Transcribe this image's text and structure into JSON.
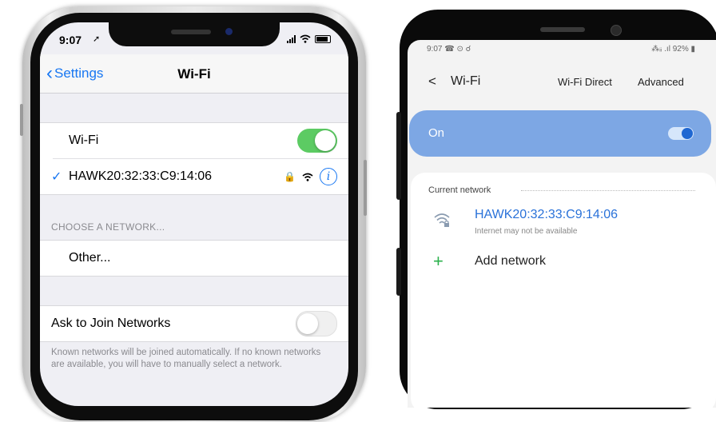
{
  "ios": {
    "status": {
      "time": "9:07"
    },
    "nav": {
      "back_label": "Settings",
      "title": "Wi-Fi"
    },
    "wifi_row": {
      "label": "Wi-Fi",
      "toggle_state": "on"
    },
    "connected_network": {
      "name": "HAWK20:32:33:C9:14:06"
    },
    "choose_header": "CHOOSE A NETWORK...",
    "other_label": "Other...",
    "ask_join": {
      "label": "Ask to Join Networks",
      "toggle_state": "off"
    },
    "footer_text": "Known networks will be joined automatically. If no known networks are available, you will have to manually select a network.",
    "accent_color": "#1877f2",
    "toggle_on_color": "#5ccb63"
  },
  "android": {
    "status": {
      "left": "9:07 ☎ ⊙ ☌",
      "right": "⁂ᵢᵢ .ıl 92% ▮"
    },
    "header": {
      "back": "<",
      "title": "Wi-Fi",
      "wifi_direct": "Wi-Fi Direct",
      "advanced": "Advanced"
    },
    "master": {
      "label": "On",
      "toggle_state": "on"
    },
    "current_network_label": "Current network",
    "network": {
      "name": "HAWK20:32:33:C9:14:06",
      "status": "Internet may not be available",
      "icon": "wifi-lock-icon"
    },
    "add_network": {
      "icon": "plus-icon",
      "label": "Add network"
    },
    "accent_color": "#2a72d9",
    "on_bar_color": "#7da7e4"
  }
}
